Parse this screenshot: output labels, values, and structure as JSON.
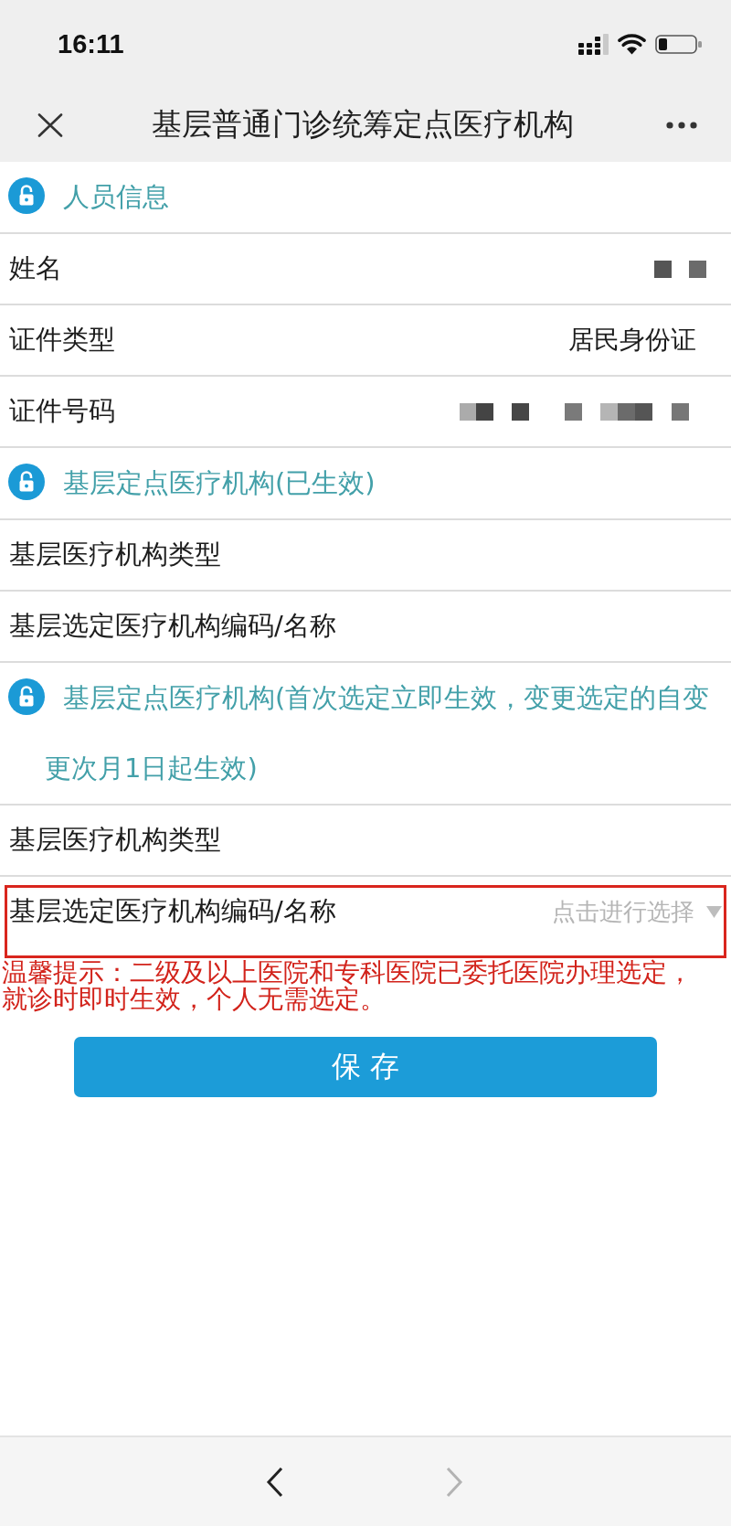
{
  "status_bar": {
    "time": "16:11"
  },
  "nav_bar": {
    "title": "基层普通门诊统筹定点医疗机构"
  },
  "sections": [
    {
      "title": "人员信息",
      "rows": [
        {
          "label": "姓名",
          "kind": "masked",
          "highlighted": false
        },
        {
          "label": "证件类型",
          "kind": "text",
          "value": "居民身份证",
          "highlighted": false
        },
        {
          "label": "证件号码",
          "kind": "masked",
          "highlighted": false
        }
      ]
    },
    {
      "title": "基层定点医疗机构(已生效)",
      "rows": [
        {
          "label": "基层医疗机构类型",
          "kind": "empty",
          "highlighted": false
        },
        {
          "label": "基层选定医疗机构编码/名称",
          "kind": "empty",
          "highlighted": false
        }
      ]
    },
    {
      "title": "基层定点医疗机构(首次选定立即生效，变更选定的自变更次月1日起生效)",
      "rows": [
        {
          "label": "基层医疗机构类型",
          "kind": "empty",
          "highlighted": false
        },
        {
          "label": "基层选定医疗机构编码/名称",
          "kind": "select",
          "placeholder": "点击进行选择",
          "highlighted": true
        }
      ]
    }
  ],
  "notice": "温馨提示：二级及以上医院和专科医院已委托医院办理选定，就诊时即时生效，个人无需选定。",
  "save_button": "保 存",
  "bottom_bar": {
    "back": {
      "disabled": false
    },
    "forward": {
      "disabled": true
    }
  }
}
